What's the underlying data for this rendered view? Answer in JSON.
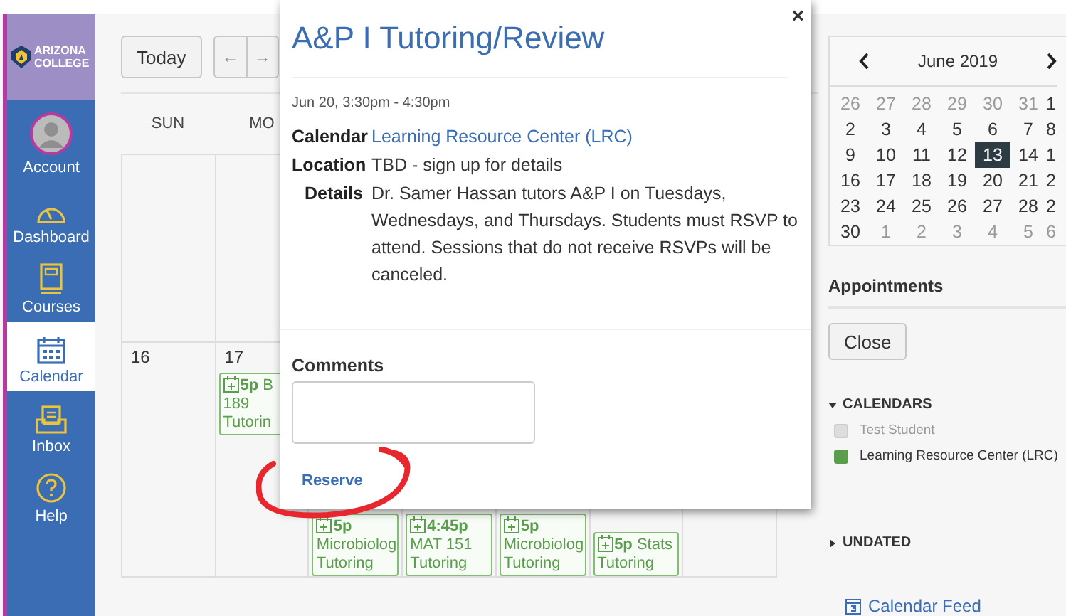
{
  "sidebar": {
    "logo": [
      "ARIZONA",
      "COLLEGE"
    ],
    "items": [
      {
        "kind": "avatar",
        "label": "Account",
        "selected": false
      },
      {
        "kind": "dashboard",
        "label": "Dashboard",
        "selected": false
      },
      {
        "kind": "courses",
        "label": "Courses",
        "selected": false
      },
      {
        "kind": "calendar",
        "label": "Calendar",
        "selected": true
      },
      {
        "kind": "inbox",
        "label": "Inbox",
        "selected": false
      },
      {
        "kind": "help",
        "label": "Help",
        "selected": false
      }
    ]
  },
  "toolbar": {
    "today": "Today",
    "prev": "←",
    "next": "→"
  },
  "calendar": {
    "weekdays": [
      "SUN",
      "MO"
    ],
    "weeks": [
      {
        "cells": [
          {},
          {},
          {},
          {},
          {},
          {},
          {}
        ]
      },
      {
        "cells": [
          {
            "date": "16"
          },
          {
            "date": "17",
            "events": [
              {
                "time": "5p",
                "title": "B 189 Tutorin"
              }
            ]
          },
          {
            "events": [
              {
                "time": "5p",
                "title": "Microbiolog Tutoring"
              }
            ]
          },
          {
            "events": [
              {
                "time": "4:45p",
                "title": "MAT 151 Tutoring"
              }
            ]
          },
          {
            "events": [
              {
                "time": "5p",
                "title": "Microbiolog Tutoring"
              }
            ]
          },
          {
            "events": [
              {
                "time": "5p",
                "title": "Stats Tutoring"
              }
            ]
          },
          {}
        ]
      }
    ]
  },
  "popover": {
    "close": "×",
    "title": "A&P I Tutoring/Review",
    "when": "Jun 20, 3:30pm - 4:30pm",
    "fields": [
      {
        "label": "Calendar",
        "value": "Learning Resource Center (LRC)",
        "kind": "link"
      },
      {
        "label": "Location",
        "value": "TBD - sign up for details",
        "kind": "text"
      },
      {
        "label": "Details",
        "value": "Dr. Samer Hassan tutors A&P I on Tuesdays, Wednesdays, and Thursdays. Students must RSVP to attend. Sessions that do not receive RSVPs will be canceled.",
        "kind": "text"
      }
    ],
    "comments_label": "Comments",
    "reserve": "Reserve"
  },
  "mini_calendar": {
    "month": "June 2019",
    "weeks": [
      [
        {
          "d": "26",
          "outside": true,
          "selected": false
        },
        {
          "d": "27",
          "outside": true,
          "selected": false
        },
        {
          "d": "28",
          "outside": true,
          "selected": false
        },
        {
          "d": "29",
          "outside": true,
          "selected": false
        },
        {
          "d": "30",
          "outside": true,
          "selected": false
        },
        {
          "d": "31",
          "outside": true,
          "selected": false
        },
        {
          "d": "1",
          "outside": false,
          "selected": false
        }
      ],
      [
        {
          "d": "2",
          "outside": false,
          "selected": false
        },
        {
          "d": "3",
          "outside": false,
          "selected": false
        },
        {
          "d": "4",
          "outside": false,
          "selected": false
        },
        {
          "d": "5",
          "outside": false,
          "selected": false
        },
        {
          "d": "6",
          "outside": false,
          "selected": false
        },
        {
          "d": "7",
          "outside": false,
          "selected": false
        },
        {
          "d": "8",
          "outside": false,
          "selected": false
        }
      ],
      [
        {
          "d": "9",
          "outside": false,
          "selected": false
        },
        {
          "d": "10",
          "outside": false,
          "selected": false
        },
        {
          "d": "11",
          "outside": false,
          "selected": false
        },
        {
          "d": "12",
          "outside": false,
          "selected": false
        },
        {
          "d": "13",
          "outside": false,
          "selected": true
        },
        {
          "d": "14",
          "outside": false,
          "selected": false
        },
        {
          "d": "1",
          "outside": false,
          "selected": false
        }
      ],
      [
        {
          "d": "16",
          "outside": false,
          "selected": false
        },
        {
          "d": "17",
          "outside": false,
          "selected": false
        },
        {
          "d": "18",
          "outside": false,
          "selected": false
        },
        {
          "d": "19",
          "outside": false,
          "selected": false
        },
        {
          "d": "20",
          "outside": false,
          "selected": false
        },
        {
          "d": "21",
          "outside": false,
          "selected": false
        },
        {
          "d": "2",
          "outside": false,
          "selected": false
        }
      ],
      [
        {
          "d": "23",
          "outside": false,
          "selected": false
        },
        {
          "d": "24",
          "outside": false,
          "selected": false
        },
        {
          "d": "25",
          "outside": false,
          "selected": false
        },
        {
          "d": "26",
          "outside": false,
          "selected": false
        },
        {
          "d": "27",
          "outside": false,
          "selected": false
        },
        {
          "d": "28",
          "outside": false,
          "selected": false
        },
        {
          "d": "2",
          "outside": false,
          "selected": false
        }
      ],
      [
        {
          "d": "30",
          "outside": false,
          "selected": false
        },
        {
          "d": "1",
          "outside": true,
          "selected": false
        },
        {
          "d": "2",
          "outside": true,
          "selected": false
        },
        {
          "d": "3",
          "outside": true,
          "selected": false
        },
        {
          "d": "4",
          "outside": true,
          "selected": false
        },
        {
          "d": "5",
          "outside": true,
          "selected": false
        },
        {
          "d": "6",
          "outside": true,
          "selected": false
        }
      ]
    ]
  },
  "appointments": {
    "title": "Appointments",
    "close": "Close"
  },
  "calendars": {
    "title": "CALENDARS",
    "expanded": true,
    "items": [
      {
        "name": "Test Student",
        "checked": false,
        "color": "#dddddd"
      },
      {
        "name": "Learning Resource Center (LRC)",
        "checked": true,
        "color": "#5a9e4b"
      }
    ]
  },
  "undated": {
    "title": "UNDATED",
    "expanded": false
  },
  "feed": {
    "label": "Calendar Feed"
  }
}
